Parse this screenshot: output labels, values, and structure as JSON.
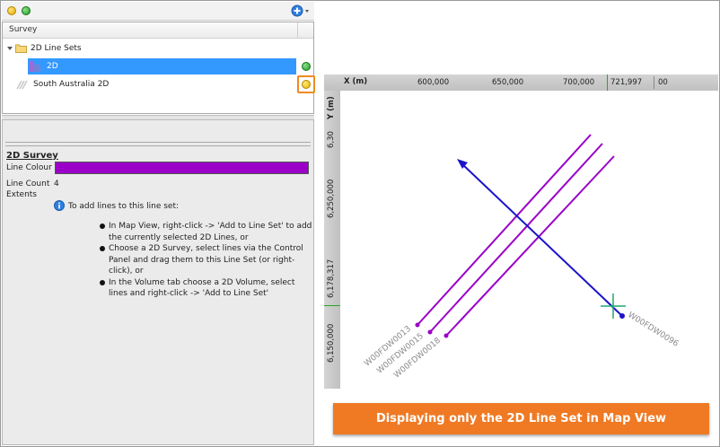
{
  "tree": {
    "column_header": "Survey",
    "items": [
      {
        "label": "2D Line Sets"
      },
      {
        "label": "2D",
        "status": "green"
      },
      {
        "label": "South Australia 2D",
        "status": "yellow"
      }
    ]
  },
  "properties": {
    "heading": "2D Survey",
    "line_colour_label": "Line Colour",
    "line_colour": "#9a00c8",
    "line_count_label": "Line Count",
    "line_count": "4",
    "extents_label": "Extents",
    "info_text": "To add lines to this line set:",
    "bullets": [
      "In Map View, right-click -> 'Add to Line Set' to add the currently selected 2D Lines, or",
      "Choose a 2D Survey, select lines via the Control Panel and drag them to this Line Set (or right-click), or",
      "In the Volume tab choose a 2D Volume, select lines and right-click -> 'Add to Line Set'"
    ]
  },
  "map": {
    "x_axis_label": "X (m)",
    "x_ticks": [
      "600,000",
      "650,000",
      "700,000",
      "721,997",
      "00"
    ],
    "y_axis_label": "Y (m)",
    "y_ticks": [
      "6,30",
      "6,250,000",
      "6,178,317",
      "6,150,000"
    ],
    "lines": [
      {
        "name": "W00FDW0013"
      },
      {
        "name": "W00FDW0015"
      },
      {
        "name": "W00FDW0018"
      },
      {
        "name": "W00FDW0096"
      }
    ]
  },
  "banner_text": "Displaying only the 2D Line Set in Map View",
  "colors": {
    "selection": "#3399ff",
    "status_green": "#2aa52a",
    "status_yellow": "#f5c400",
    "highlight_box": "#f08a24",
    "line_set": "#9a00c8",
    "selected_line": "#1a14c8",
    "banner": "#f07a24"
  }
}
